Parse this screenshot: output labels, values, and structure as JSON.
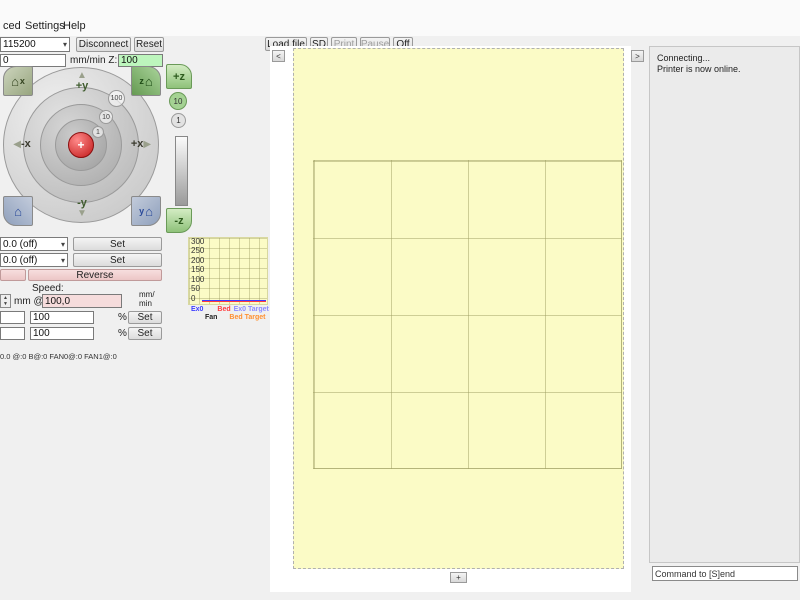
{
  "menu": {
    "items": [
      "ced",
      "Settings",
      "Help"
    ]
  },
  "connection": {
    "baud_value": "115200",
    "disconnect_label": "Disconnect",
    "reset_label": "Reset",
    "xy_speed_value": "0",
    "z_speed_label": "mm/min Z:",
    "z_speed_value": "100"
  },
  "toolbar": {
    "load_file": "Load file",
    "sd": "SD",
    "print": "Print",
    "pause": "Pause",
    "off": "Off"
  },
  "jog": {
    "y_plus": "+y",
    "y_minus": "-y",
    "x_plus": "+x",
    "x_minus": "-x",
    "home_x": "x",
    "home_y": "y",
    "home_z": "z",
    "ring_steps": [
      "100",
      "10",
      "1"
    ],
    "z_plus": "+z",
    "z_minus": "-z",
    "z_steps": [
      "10",
      "1"
    ]
  },
  "heaters": {
    "heater_value": "0.0 (off)",
    "heater_set": "Set",
    "bed_value": "0.0 (off)",
    "bed_set": "Set"
  },
  "extrusion": {
    "reverse_label": "Reverse",
    "speed_label": "Speed:",
    "mm_at_label": "mm @",
    "length_value": "100,0",
    "rate_unit_line1": "mm/",
    "rate_unit_line2": "min",
    "multiplier1_value": "100",
    "multiplier2_value": "100",
    "percent_label": "%",
    "set_label": "Set"
  },
  "status_line": "0.0 @:0 B@:0 FAN0@:0 FAN1@:0",
  "temp_graph": {
    "type": "line",
    "y_ticks": [
      "300",
      "250",
      "200",
      "150",
      "100",
      "50",
      "0"
    ],
    "y_range": [
      0,
      300
    ],
    "series": [
      {
        "name": "Ex0",
        "color": "#3c3cff",
        "value": 0
      },
      {
        "name": "Bed",
        "color": "#ff3c3c",
        "value": 0
      }
    ],
    "legend_row1": [
      {
        "label": "Ex0",
        "color": "#3c3cff"
      },
      {
        "label": "Bed",
        "color": "#ff3c3c"
      },
      {
        "label": "Ex0 Target",
        "color": "#8c8cff"
      }
    ],
    "legend_row2": [
      {
        "label": "Fan",
        "color": "#222222"
      },
      {
        "label": "Bed Target",
        "color": "#ff9030"
      }
    ],
    "bg": "#fbfbc6"
  },
  "plate": {
    "bg": "#fbfbc6",
    "grid_rows": 4,
    "grid_cols": 4
  },
  "viewport": {
    "collapse_left": "<",
    "collapse_right": ">",
    "expand": "+"
  },
  "log": {
    "lines": [
      "Connecting...",
      "Printer is now online."
    ]
  },
  "command": {
    "value": "Command to [S]end"
  },
  "icons": {
    "home": "⌂",
    "dropdown": "▾",
    "spin_up": "▲",
    "spin_down": "▼",
    "arrow_up": "▲",
    "arrow_down": "▼",
    "arrow_left": "◀",
    "arrow_right": "▶",
    "crosshair": "+"
  },
  "colors": {
    "accent_green_input": "#bdf6bd",
    "pink_button": "#f0cfcf",
    "plate_yellow": "#fbfbc6",
    "disabled_text": "#9f9f9f"
  }
}
